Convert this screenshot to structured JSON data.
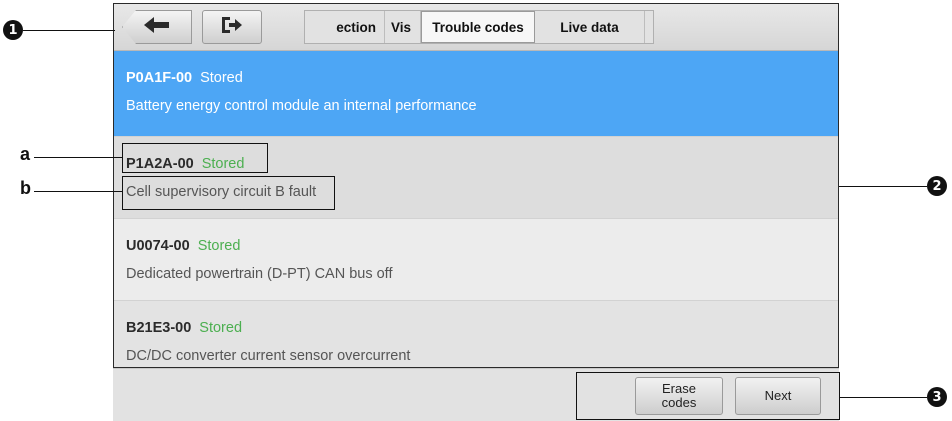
{
  "toolbar": {
    "tabs": [
      {
        "label": "Inspection"
      },
      {
        "label": "Vis"
      },
      {
        "label": "Trouble codes"
      },
      {
        "label": "Live data"
      }
    ],
    "active_tab": "Trouble codes"
  },
  "dtc_list": [
    {
      "code": "P0A1F-00",
      "status": "Stored",
      "description": "Battery energy control module an internal performance"
    },
    {
      "code": "P1A2A-00",
      "status": "Stored",
      "description": "Cell supervisory circuit B fault"
    },
    {
      "code": "U0074-00",
      "status": "Stored",
      "description": "Dedicated powertrain (D-PT) CAN bus off"
    },
    {
      "code": "B21E3-00",
      "status": "Stored",
      "description": "DC/DC converter current sensor overcurrent"
    }
  ],
  "bottom": {
    "erase_label_line1": "Erase",
    "erase_label_line2": "codes",
    "next_label": "Next"
  },
  "callouts": {
    "n1": "1",
    "n2": "2",
    "n3": "3",
    "a": "a",
    "b": "b"
  },
  "colors": {
    "selected_row": "#4da6f5",
    "status_green": "#4caf50"
  }
}
